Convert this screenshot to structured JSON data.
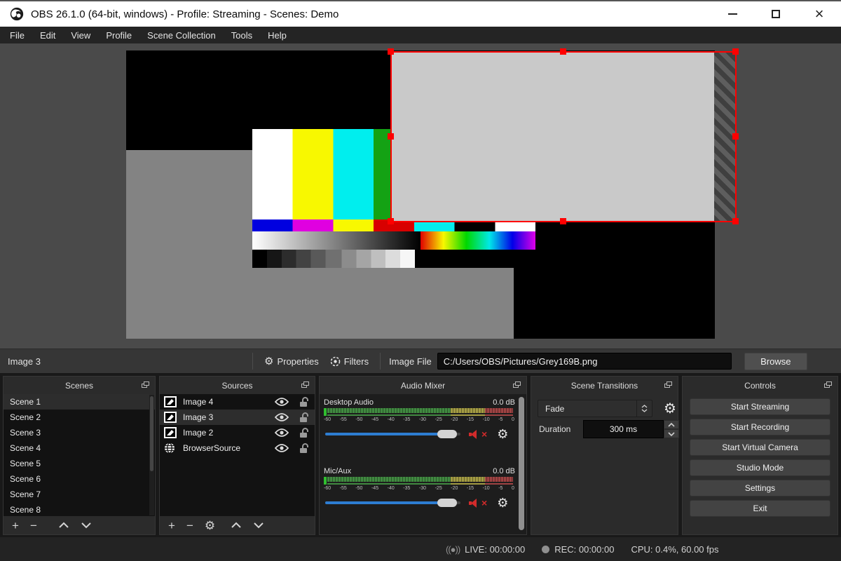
{
  "window": {
    "title": "OBS 26.1.0 (64-bit, windows) - Profile: Streaming - Scenes: Demo",
    "minimize": "minimize",
    "maximize": "maximize",
    "close": "close"
  },
  "menu": {
    "items": [
      "File",
      "Edit",
      "View",
      "Profile",
      "Scene Collection",
      "Tools",
      "Help"
    ]
  },
  "toolbar": {
    "source_name": "Image 3",
    "properties_label": "Properties",
    "filters_label": "Filters",
    "image_file_label": "Image File",
    "image_file_value": "C:/Users/OBS/Pictures/Grey169B.png",
    "browse_label": "Browse"
  },
  "scenes": {
    "title": "Scenes",
    "selected": "Scene 1",
    "items": [
      "Scene 1",
      "Scene 2",
      "Scene 3",
      "Scene 4",
      "Scene 5",
      "Scene 6",
      "Scene 7",
      "Scene 8"
    ]
  },
  "sources": {
    "title": "Sources",
    "selected": "Image 3",
    "items": [
      {
        "name": "Image 4",
        "type": "image"
      },
      {
        "name": "Image 3",
        "type": "image"
      },
      {
        "name": "Image 2",
        "type": "image"
      },
      {
        "name": "BrowserSource",
        "type": "browser"
      }
    ]
  },
  "audio_mixer": {
    "title": "Audio Mixer",
    "channels": [
      {
        "name": "Desktop Audio",
        "level": "0.0 dB",
        "muted": true
      },
      {
        "name": "Mic/Aux",
        "level": "0.0 dB",
        "muted": true
      }
    ],
    "scale_ticks": [
      "-60",
      "-55",
      "-50",
      "-45",
      "-40",
      "-35",
      "-30",
      "-25",
      "-20",
      "-15",
      "-10",
      "-5",
      "0"
    ]
  },
  "transitions": {
    "title": "Scene Transitions",
    "transition": "Fade",
    "duration_label": "Duration",
    "duration_value": "300 ms"
  },
  "controls": {
    "title": "Controls",
    "buttons": [
      "Start Streaming",
      "Start Recording",
      "Start Virtual Camera",
      "Studio Mode",
      "Settings",
      "Exit"
    ]
  },
  "statusbar": {
    "live": "LIVE: 00:00:00",
    "rec": "REC: 00:00:00",
    "cpu": "CPU: 0.4%, 60.00 fps"
  },
  "colors": {
    "selection": "#ff0000",
    "slider": "#2d7dd2",
    "mute": "#d22b2b"
  }
}
